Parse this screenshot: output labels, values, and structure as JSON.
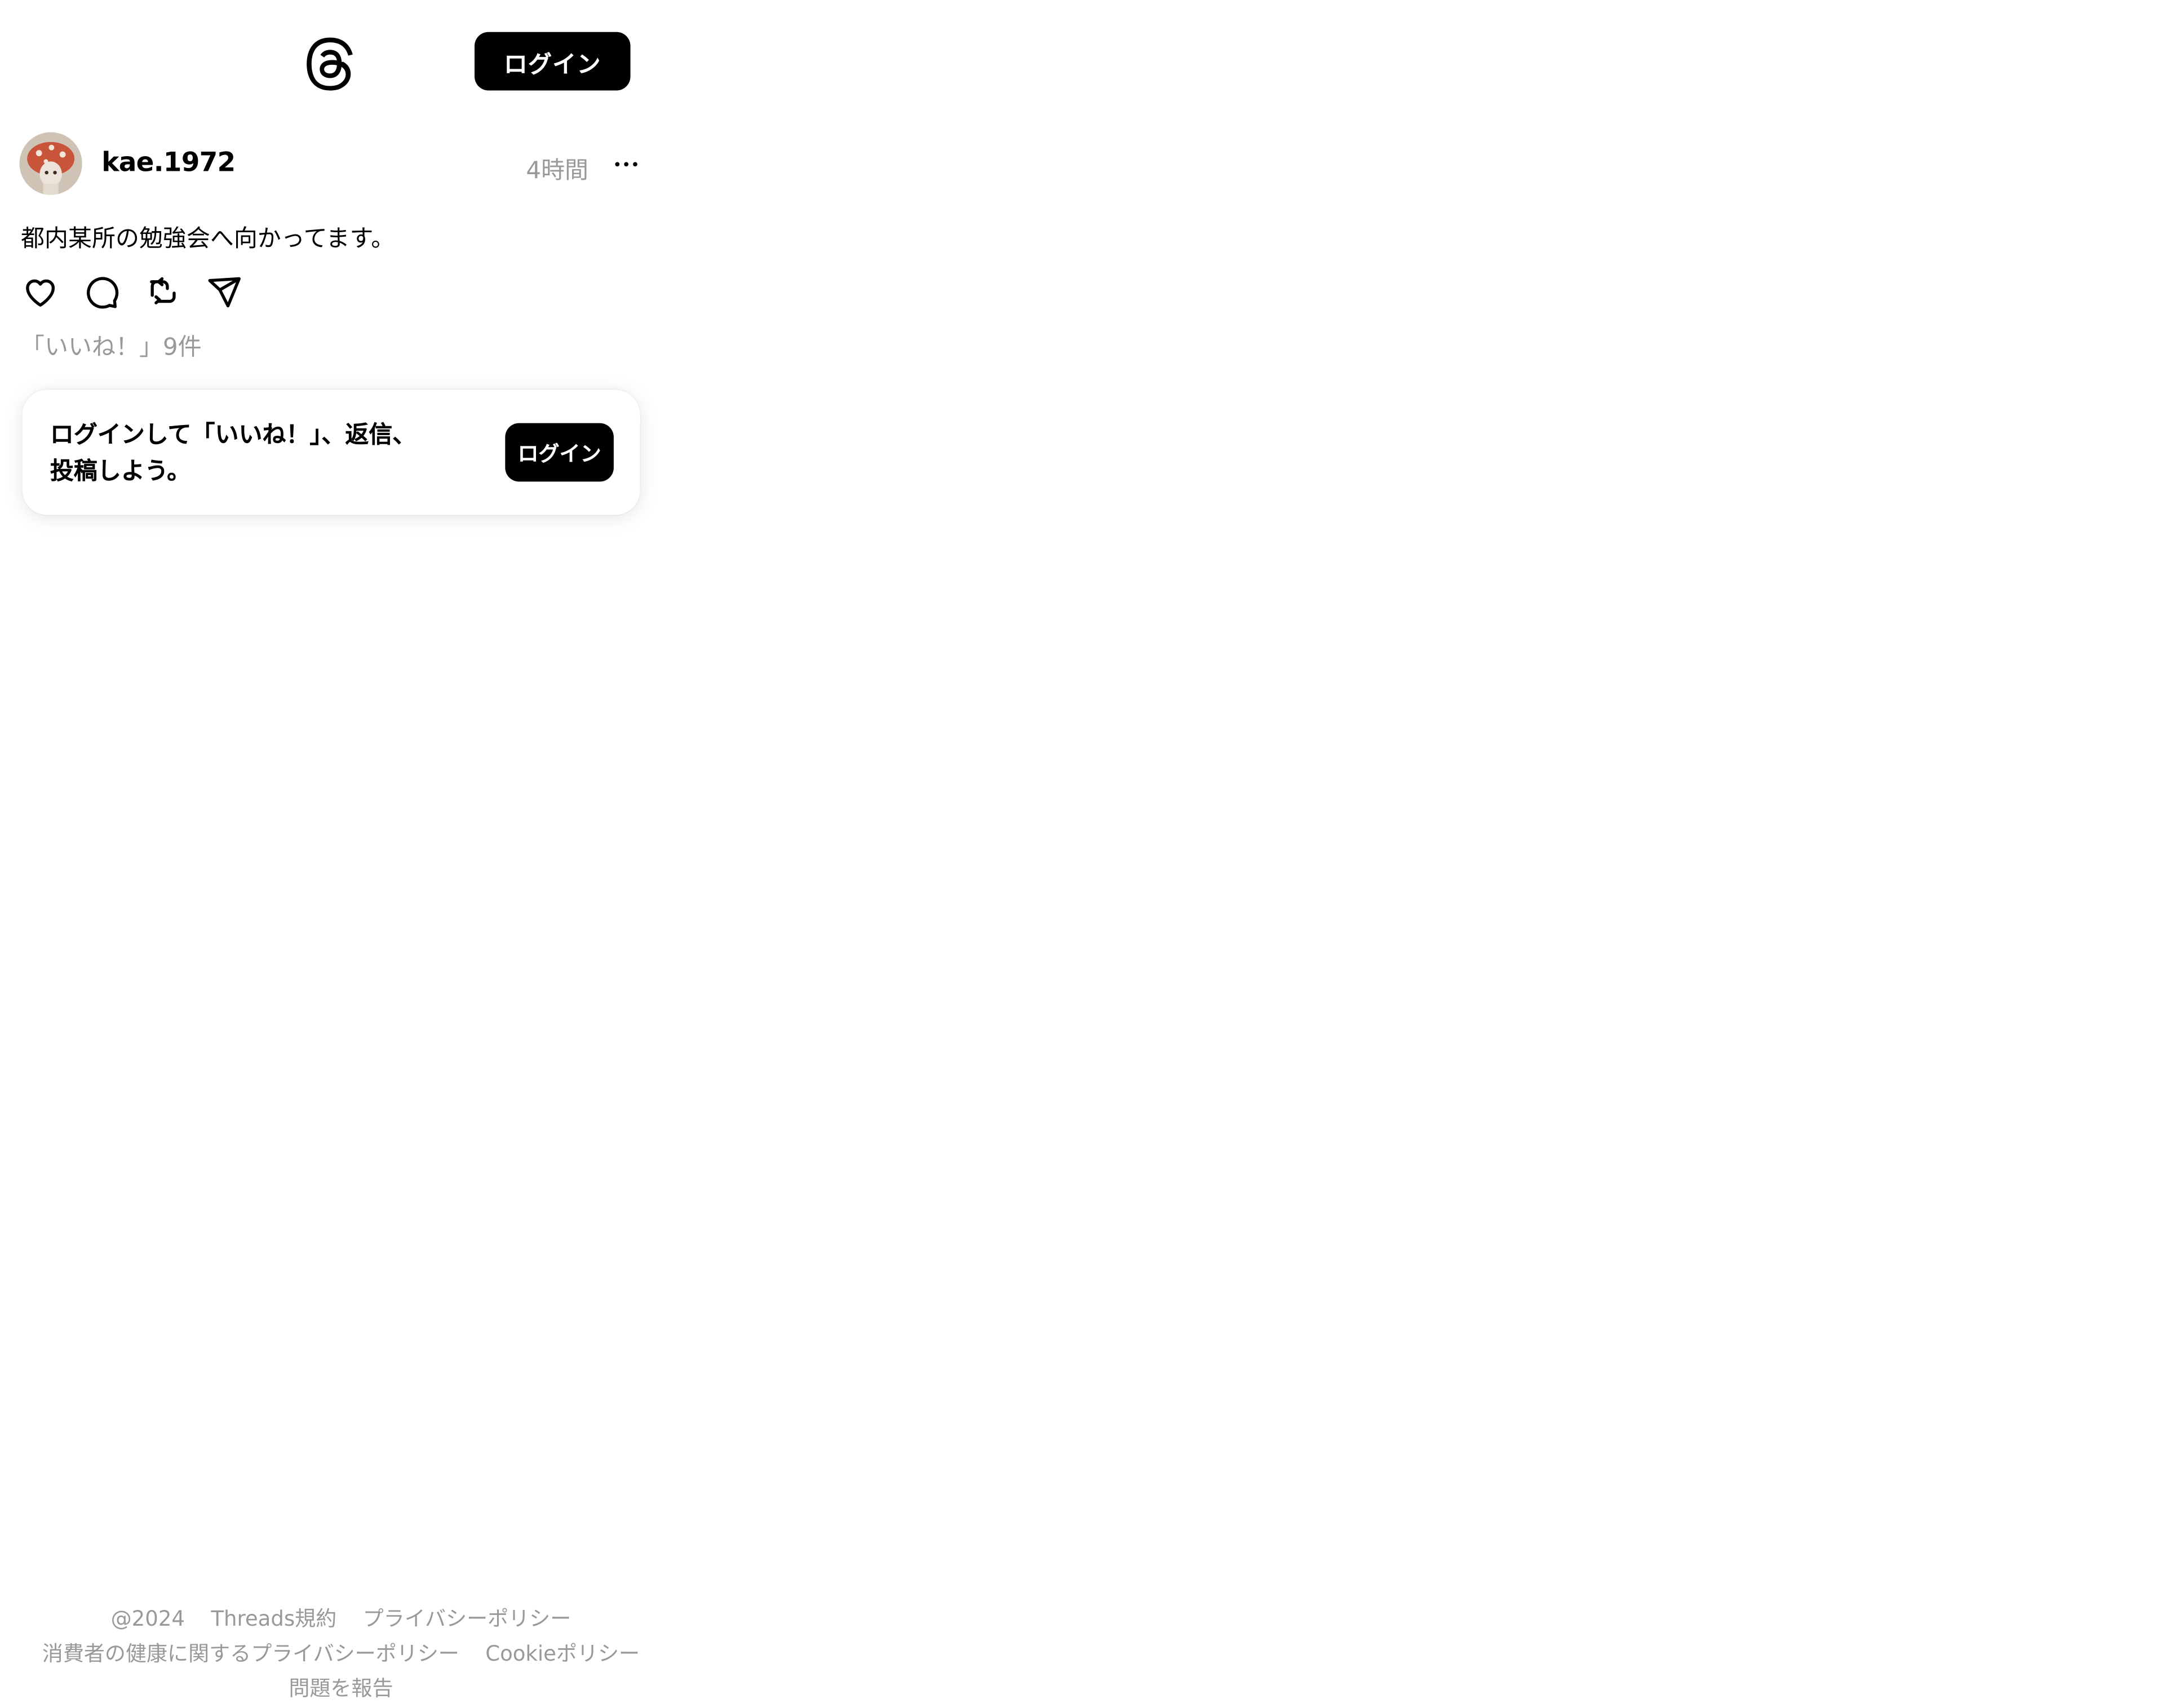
{
  "header": {
    "login_label": "ログイン"
  },
  "post": {
    "username": "kae.1972",
    "timestamp": "4時間",
    "text": "都内某所の勉強会へ向かってます。",
    "likes_text": "「いいね！」9件",
    "icons": [
      "heart-icon",
      "comment-icon",
      "repost-icon",
      "share-icon",
      "more-icon"
    ]
  },
  "login_prompt": {
    "message_line1": "ログインして「いいね！」、返信、",
    "message_line2": "投稿しよう。",
    "button_label": "ログイン"
  },
  "footer": {
    "copyright": "@2024",
    "terms": "Threads規約",
    "privacy": "プライバシーポリシー",
    "health_privacy": "消費者の健康に関するプライバシーポリシー",
    "cookie": "Cookieポリシー",
    "report": "問題を報告"
  }
}
